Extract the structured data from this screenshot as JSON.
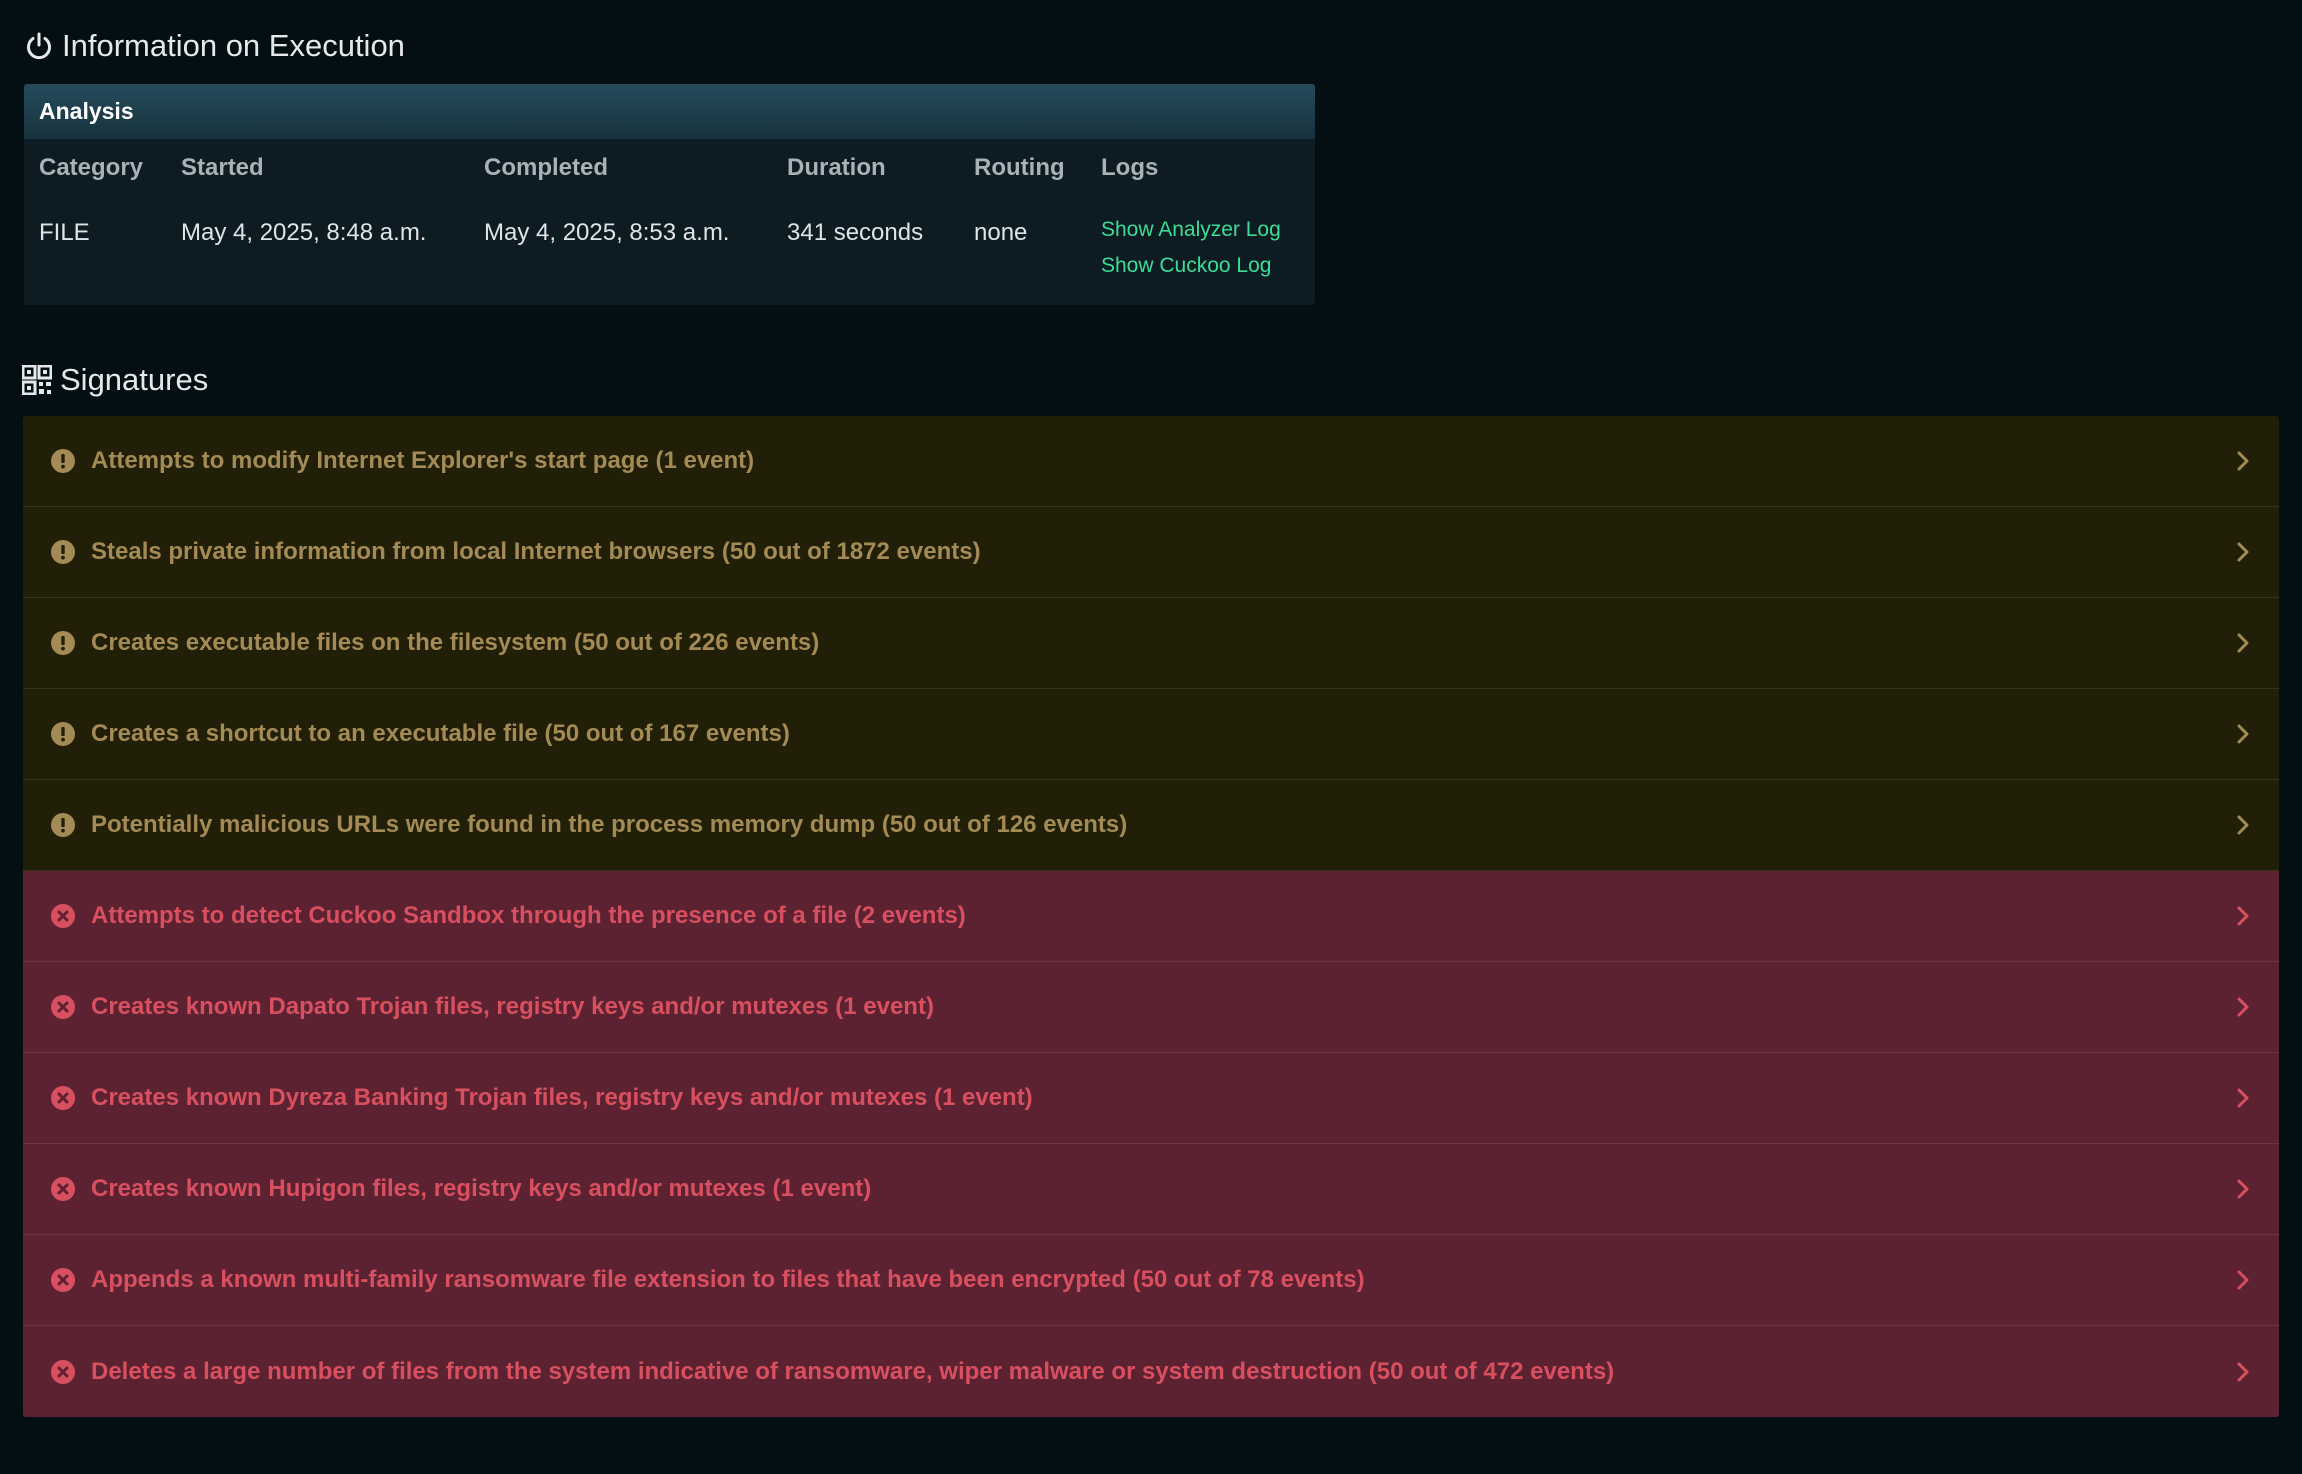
{
  "execution": {
    "title": "Information on Execution",
    "icon": "power-icon",
    "panel_title": "Analysis",
    "columns": {
      "category": "Category",
      "started": "Started",
      "completed": "Completed",
      "duration": "Duration",
      "routing": "Routing",
      "logs": "Logs"
    },
    "row": {
      "category": "FILE",
      "started": "May 4, 2025, 8:48 a.m.",
      "completed": "May 4, 2025, 8:53 a.m.",
      "duration": "341 seconds",
      "routing": "none",
      "analyzer_log": "Show Analyzer Log",
      "cuckoo_log": "Show Cuckoo Log"
    }
  },
  "signatures": {
    "title": "Signatures",
    "icon": "qrcode-icon",
    "items": [
      {
        "severity": "warning",
        "icon": "exclamation-circle-icon",
        "text": "Attempts to modify Internet Explorer's start page (1 event)"
      },
      {
        "severity": "warning",
        "icon": "exclamation-circle-icon",
        "text": "Steals private information from local Internet browsers (50 out of 1872 events)"
      },
      {
        "severity": "warning",
        "icon": "exclamation-circle-icon",
        "text": "Creates executable files on the filesystem (50 out of 226 events)"
      },
      {
        "severity": "warning",
        "icon": "exclamation-circle-icon",
        "text": "Creates a shortcut to an executable file (50 out of 167 events)"
      },
      {
        "severity": "warning",
        "icon": "exclamation-circle-icon",
        "text": "Potentially malicious URLs were found in the process memory dump (50 out of 126 events)"
      },
      {
        "severity": "danger",
        "icon": "times-circle-icon",
        "text": "Attempts to detect Cuckoo Sandbox through the presence of a file (2 events)"
      },
      {
        "severity": "danger",
        "icon": "times-circle-icon",
        "text": "Creates known Dapato Trojan files, registry keys and/or mutexes (1 event)"
      },
      {
        "severity": "danger",
        "icon": "times-circle-icon",
        "text": "Creates known Dyreza Banking Trojan files, registry keys and/or mutexes (1 event)"
      },
      {
        "severity": "danger",
        "icon": "times-circle-icon",
        "text": "Creates known Hupigon files, registry keys and/or mutexes (1 event)"
      },
      {
        "severity": "danger",
        "icon": "times-circle-icon",
        "text": "Appends a known multi-family ransomware file extension to files that have been encrypted (50 out of 78 events)"
      },
      {
        "severity": "danger",
        "icon": "times-circle-icon",
        "text": "Deletes a large number of files from the system indicative of ransomware, wiper malware or system destruction (50 out of 472 events)"
      }
    ]
  },
  "colors": {
    "background": "#040f13",
    "panel": "#0d1b22",
    "link": "#3ddc97",
    "warning_bg": "#211f07",
    "warning_text": "#a48a54",
    "danger_bg": "#5d2232",
    "danger_text": "#d8505f"
  }
}
